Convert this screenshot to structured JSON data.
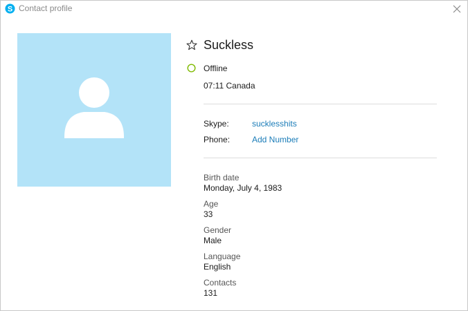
{
  "window": {
    "title": "Contact profile",
    "app_icon": "skype-icon",
    "close_icon": "close-icon"
  },
  "contact": {
    "name": "Suckless",
    "favorite_icon": "star-outline-icon",
    "status": "Offline",
    "status_icon": "offline-status-icon",
    "status_color": "#7fba00",
    "local_time": "07:11 Canada"
  },
  "accounts": {
    "skype_label": "Skype:",
    "skype_value": "sucklesshits",
    "phone_label": "Phone:",
    "phone_value": "Add Number"
  },
  "details": [
    {
      "label": "Birth date",
      "value": "Monday, July 4, 1983"
    },
    {
      "label": "Age",
      "value": "33"
    },
    {
      "label": "Gender",
      "value": "Male"
    },
    {
      "label": "Language",
      "value": "English"
    },
    {
      "label": "Contacts",
      "value": "131"
    }
  ],
  "colors": {
    "avatar_background": "#b3e3f8",
    "link": "#1a7cb8",
    "skype_brand": "#00aff0"
  }
}
